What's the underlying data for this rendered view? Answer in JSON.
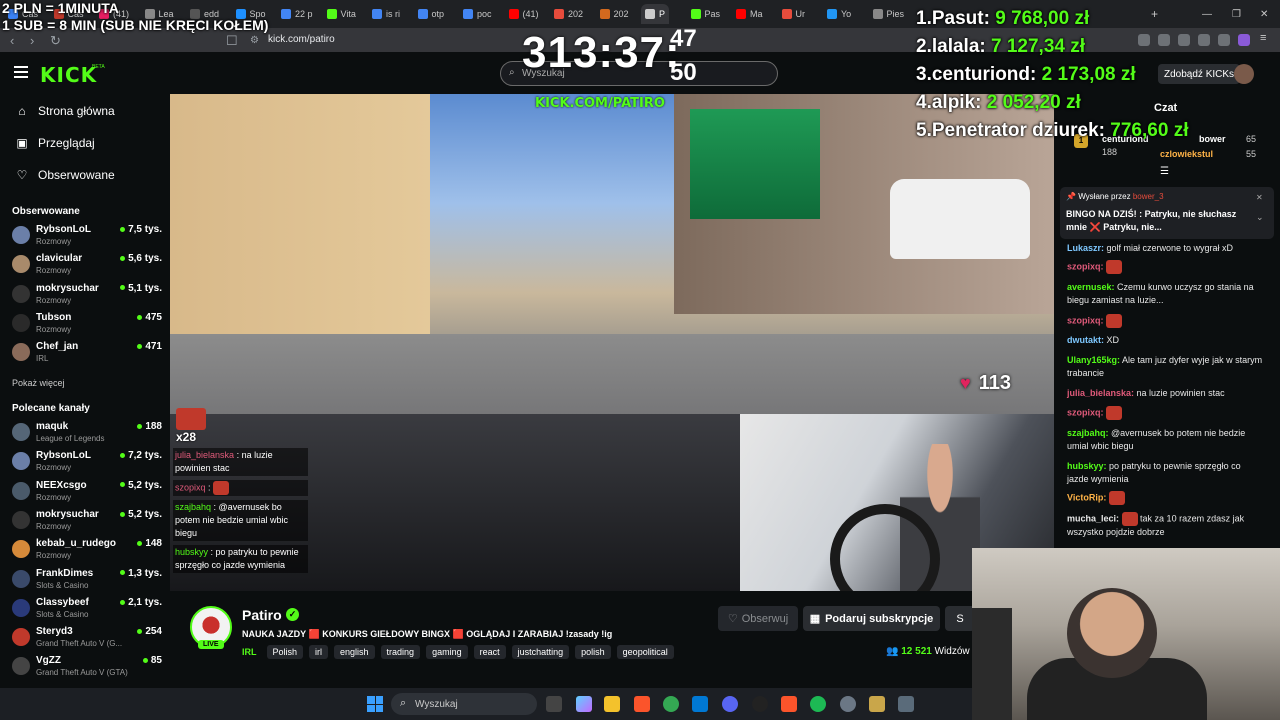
{
  "overlay": {
    "line1": "2 PLN = 1MINUTA",
    "line2": "1 SUB = 8 MIN (SUB NIE KRĘCI KOŁEM)",
    "timer": "313:37:",
    "timer_side": "47\n50"
  },
  "browser": {
    "url": "kick.com/patiro",
    "tabs": [
      "Cas",
      "Cas",
      "(41)",
      "Lea",
      "edd",
      "Spo",
      "22 p",
      "Vita",
      "is ri",
      "otp",
      "poc",
      "(41)",
      "202",
      "202",
      "P",
      "Pas",
      "Ma",
      "Ur",
      "Yo",
      "Pies"
    ]
  },
  "header": {
    "logo": "KICK",
    "beta": "BETA",
    "search_placeholder": "Wyszukaj",
    "get_kicks": "Zdobądź KICKs"
  },
  "leaderboard": [
    {
      "rank": "1.",
      "name": "Pasut:",
      "amount": "9 768,00 zł"
    },
    {
      "rank": "2.",
      "name": "lalala:",
      "amount": "7 127,34 zł"
    },
    {
      "rank": "3.",
      "name": "centuriond:",
      "amount": "2 173,08 zł"
    },
    {
      "rank": "4.",
      "name": "alpik:",
      "amount": "2 052,20 zł"
    },
    {
      "rank": "5.",
      "name": "Penetrator dziurek:",
      "amount": "776,60 zł"
    }
  ],
  "sidebar": {
    "nav": [
      {
        "label": "Strona główna",
        "icon": "home-icon"
      },
      {
        "label": "Przeglądaj",
        "icon": "browse-icon"
      },
      {
        "label": "Obserwowane",
        "icon": "heart-icon"
      }
    ],
    "followed_title": "Obserwowane",
    "followed": [
      {
        "name": "RybsonLoL",
        "category": "Rozmowy",
        "viewers": "7,5 tys.",
        "color": "#6b7fa8"
      },
      {
        "name": "clavicular",
        "category": "Rozmowy",
        "viewers": "5,6 tys.",
        "color": "#a88a6b"
      },
      {
        "name": "mokrysuchar",
        "category": "Rozmowy",
        "viewers": "5,1 tys.",
        "color": "#333333"
      },
      {
        "name": "Tubson",
        "category": "Rozmowy",
        "viewers": "475",
        "color": "#2a2a2a"
      },
      {
        "name": "Chef_jan",
        "category": "IRL",
        "viewers": "471",
        "color": "#8a6b5a"
      }
    ],
    "show_more": "Pokaż więcej",
    "recommended_title": "Polecane kanały",
    "recommended": [
      {
        "name": "maquk",
        "category": "League of Legends",
        "viewers": "188",
        "color": "#556677"
      },
      {
        "name": "RybsonLoL",
        "category": "Rozmowy",
        "viewers": "7,2 tys.",
        "color": "#6b7fa8"
      },
      {
        "name": "NEEXcsgo",
        "category": "Rozmowy",
        "viewers": "5,2 tys.",
        "color": "#4a5a6a"
      },
      {
        "name": "mokrysuchar",
        "category": "Rozmowy",
        "viewers": "5,2 tys.",
        "color": "#333333"
      },
      {
        "name": "kebab_u_rudego",
        "category": "Rozmowy",
        "viewers": "148",
        "color": "#d68a3a"
      },
      {
        "name": "FrankDimes",
        "category": "Slots & Casino",
        "viewers": "1,3 tys.",
        "color": "#3a4a6a"
      },
      {
        "name": "Classybeef",
        "category": "Slots & Casino",
        "viewers": "2,1 tys.",
        "color": "#2a3a7a"
      },
      {
        "name": "Steryd3",
        "category": "Grand Theft Auto V (G...",
        "viewers": "254",
        "color": "#c0392b"
      },
      {
        "name": "VgZZ",
        "category": "Grand Theft Auto V (GTA)",
        "viewers": "85",
        "color": "#444444"
      }
    ]
  },
  "video": {
    "watermark": "KICK.COM/PATIRO",
    "heart_rate": "113",
    "emote_count": "x28",
    "overlay_chat": [
      {
        "user": "julia_bielanska",
        "text": ": na luzie powinien stac",
        "color": "#e05a7a"
      },
      {
        "user": "szopixq",
        "text": ":",
        "color": "#e05a7a",
        "emote": true
      },
      {
        "user": "szajbahq",
        "text": ": @avernusek bo potem nie bedzie umial wbic biegu",
        "color": "#53fc18"
      },
      {
        "user": "hubskyy",
        "text": ": po patryku to pewnie sprzęgło co jazde wymienia",
        "color": "#53fc18"
      }
    ]
  },
  "stream": {
    "streamer": "Patiro",
    "live": "LIVE",
    "title": "NAUKA JAZDY 🟥 KONKURS GIEŁDOWY BINGX 🟥 OGLĄDAJ I ZARABIAJ !zasady !ig",
    "category": "IRL",
    "tags": [
      "Polish",
      "irl",
      "english",
      "trading",
      "gaming",
      "react",
      "justchatting",
      "polish",
      "geopolitical"
    ],
    "follow": "Obserwuj",
    "subscribe": "Podaruj subskrypcje",
    "more": "S",
    "viewers_count": "12 521",
    "viewers_label": "Widzów"
  },
  "chat": {
    "title": "Czat",
    "gifters": [
      {
        "name": "centuriond",
        "count": "188"
      },
      {
        "name": "bower",
        "count": "65"
      },
      {
        "name": "czlowiekstul",
        "count": "55"
      }
    ],
    "pinned_by_label": "Wysłane przez",
    "pinned_by_user": "bower_3",
    "pinned_text": "BINGO NA DZIŚ! : Patryku, nie słuchasz mnie ❌ Patryku, nie...",
    "messages": [
      {
        "user": "Lukaszr:",
        "text": " golf miał czerwone to wygrał xD",
        "color": "#7ec8ff"
      },
      {
        "user": "szopixq:",
        "text": "",
        "color": "#e05a7a",
        "emote": true
      },
      {
        "user": "avernusek:",
        "text": " Czemu kurwo uczysz go stania na biegu zamiast na luzie...",
        "color": "#53fc18"
      },
      {
        "user": "szopixq:",
        "text": "",
        "color": "#e05a7a",
        "emote": true
      },
      {
        "user": "dwutakt:",
        "text": " XD",
        "color": "#7ec8ff"
      },
      {
        "user": "Ulany165kg:",
        "text": " Ale tam juz dyfer wyje jak w starym trabancie",
        "color": "#53fc18"
      },
      {
        "user": "julia_bielanska:",
        "text": " na luzie powinien stac",
        "color": "#e05a7a"
      },
      {
        "user": "szopixq:",
        "text": "",
        "color": "#e05a7a",
        "emote": true
      },
      {
        "user": "szajbahq:",
        "text": " @avernusek bo potem nie bedzie umial wbic biegu",
        "color": "#53fc18"
      },
      {
        "user": "hubskyy:",
        "text": " po patryku to pewnie sprzęgło co jazde wymienia",
        "color": "#53fc18"
      },
      {
        "user": "VictoRip:",
        "text": "",
        "color": "#ffb347",
        "emote": true
      },
      {
        "user": "mucha_leci:",
        "text": " tak za 10 razem zdasz jak wszystko pojdzie dobrze",
        "color": "#e8e8e8",
        "emote": true
      }
    ]
  },
  "taskbar": {
    "search": "Wyszukaj"
  }
}
